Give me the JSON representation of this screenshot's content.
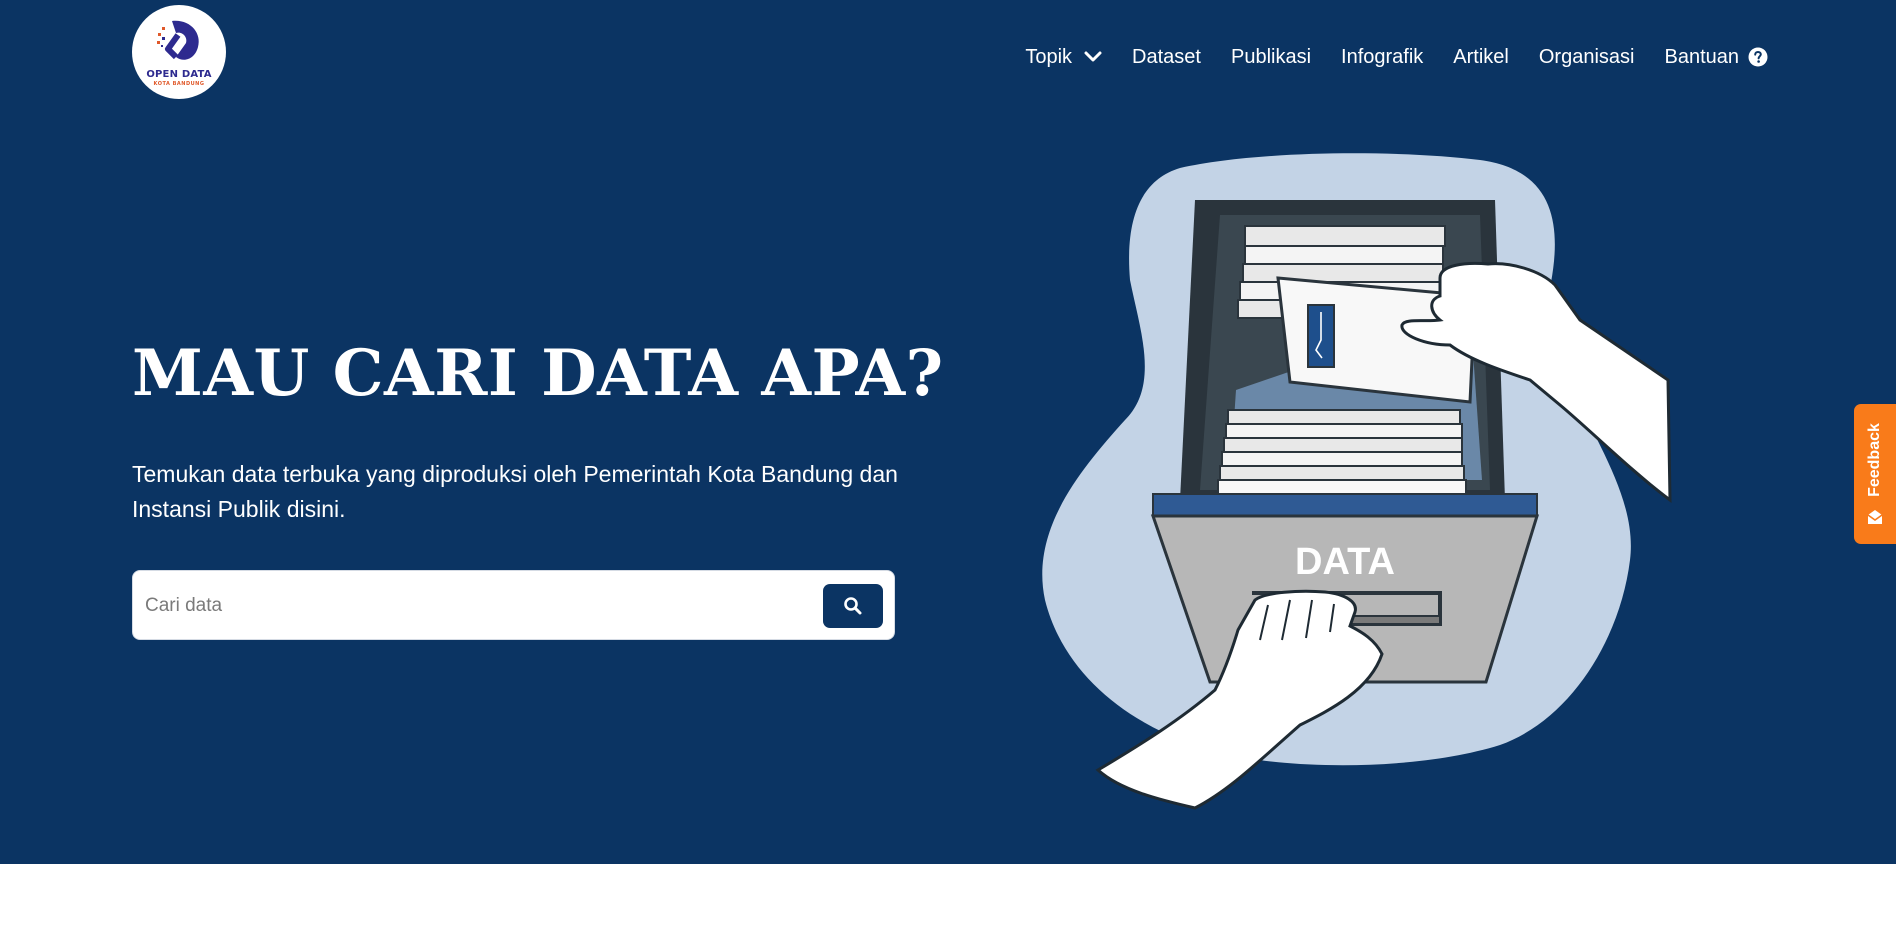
{
  "brand": {
    "logo_line1": "OPEN DATA",
    "logo_line2": "KOTA BANDUNG",
    "colors": {
      "primary": "#0b3463",
      "accent": "#f97b1a",
      "logo_purple": "#2d2a8f"
    }
  },
  "nav": {
    "items": [
      {
        "label": "Topik",
        "icon": "chevron-down-icon"
      },
      {
        "label": "Dataset"
      },
      {
        "label": "Publikasi"
      },
      {
        "label": "Infografik"
      },
      {
        "label": "Artikel"
      },
      {
        "label": "Organisasi"
      },
      {
        "label": "Bantuan",
        "icon": "help-circle-icon"
      }
    ]
  },
  "hero": {
    "title": "MAU CARI DATA APA?",
    "subtitle": "Temukan data terbuka yang diproduksi oleh Pemerintah Kota Bandung dan Instansi Publik disini."
  },
  "search": {
    "placeholder": "Cari data",
    "button_icon": "search-icon"
  },
  "illustration": {
    "drawer_label": "DATA"
  },
  "feedback": {
    "label": "Feedback",
    "icon": "mail-icon"
  }
}
